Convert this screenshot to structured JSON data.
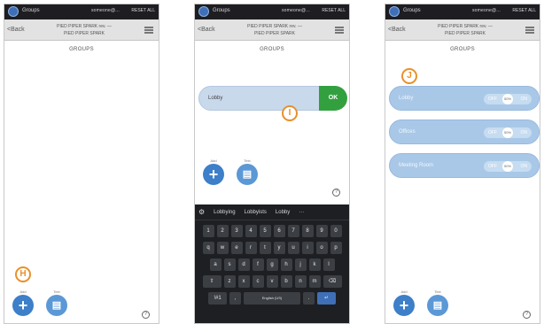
{
  "status_bar": {
    "app_name": "Groups",
    "email": "someone@...",
    "reset": "RESET ALL"
  },
  "nav": {
    "back": "<Back",
    "title_line1": "PIED PIPER SPARK rev. —",
    "title_line2": "PIED PIPER SPARK"
  },
  "heading": "GROUPS",
  "actions": {
    "add_label": "Add",
    "text_label": "Text",
    "add_symbol": "+",
    "text_symbol": "▤"
  },
  "help_symbol": "?",
  "markers": {
    "h": "H",
    "i": "I",
    "j": "J"
  },
  "screen2": {
    "input_value": "Lobby",
    "ok_label": "OK",
    "keyboard": {
      "settings_symbol": "⚙",
      "suggestions": [
        "Lobbying",
        "Lobbyists",
        "Lobby"
      ],
      "more_symbol": "···",
      "rows": [
        [
          "1",
          "2",
          "3",
          "4",
          "5",
          "6",
          "7",
          "8",
          "9",
          "0"
        ],
        [
          "q",
          "w",
          "e",
          "r",
          "t",
          "y",
          "u",
          "i",
          "o",
          "p"
        ],
        [
          "a",
          "s",
          "d",
          "f",
          "g",
          "h",
          "j",
          "k",
          "l"
        ],
        [
          "⇧",
          "z",
          "x",
          "c",
          "v",
          "b",
          "n",
          "m",
          "⌫"
        ],
        [
          "!#1",
          ",",
          "English (US)",
          ".",
          "↵"
        ]
      ]
    }
  },
  "screen3": {
    "groups": [
      {
        "name": "Lobby"
      },
      {
        "name": "Offices"
      },
      {
        "name": "Meeting Room"
      }
    ],
    "toggle": {
      "off": "OFF",
      "mid": "50%",
      "on": "ON"
    }
  },
  "colors": {
    "accent": "#3d7fc8",
    "ok_green": "#33a040",
    "marker_orange": "#e8912b",
    "group_bar": "#a9c8e8"
  }
}
